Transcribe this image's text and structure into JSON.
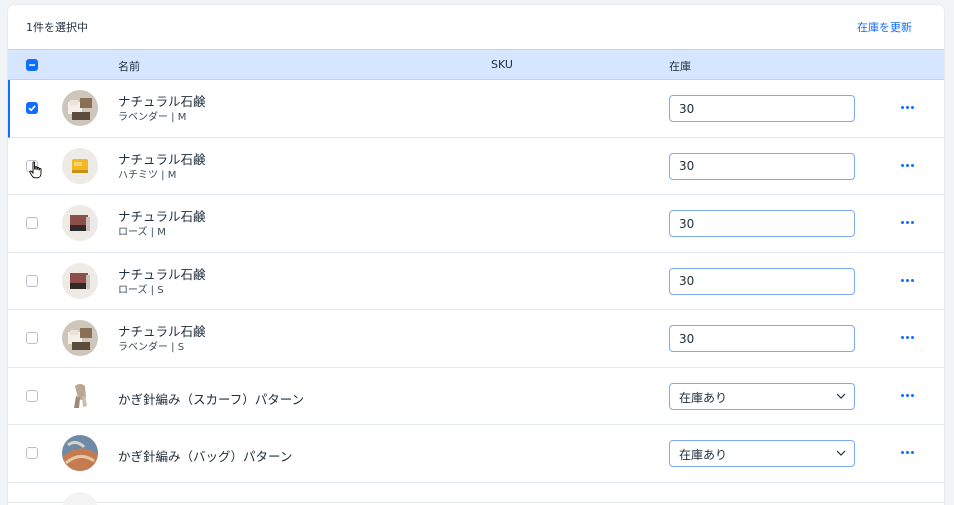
{
  "toolbar": {
    "selected_count": "1件を選択中",
    "update_stock": "在庫を更新"
  },
  "columns": {
    "name": "名前",
    "sku": "SKU",
    "stock": "在庫"
  },
  "rows": [
    {
      "name": "ナチュラル石鹸",
      "variant": "ラベンダー | M",
      "stock": "30",
      "selected": true,
      "thumb": "lavender"
    },
    {
      "name": "ナチュラル石鹸",
      "variant": "ハチミツ | M",
      "stock": "30",
      "selected": false,
      "thumb": "honey"
    },
    {
      "name": "ナチュラル石鹸",
      "variant": "ローズ | M",
      "stock": "30",
      "selected": false,
      "thumb": "rose"
    },
    {
      "name": "ナチュラル石鹸",
      "variant": "ローズ | S",
      "stock": "30",
      "selected": false,
      "thumb": "rose"
    },
    {
      "name": "ナチュラル石鹸",
      "variant": "ラベンダー | S",
      "stock": "30",
      "selected": false,
      "thumb": "lavender"
    },
    {
      "name": "かぎ針編み（スカーフ）パターン",
      "variant": "",
      "stock": "在庫あり",
      "selected": false,
      "thumb": "scarf"
    },
    {
      "name": "かぎ針編み（バッグ）パターン",
      "variant": "",
      "stock": "在庫あり",
      "selected": false,
      "thumb": "bag"
    }
  ],
  "colors": {
    "accent": "#116dff",
    "header_bg": "#d6e6fe"
  }
}
